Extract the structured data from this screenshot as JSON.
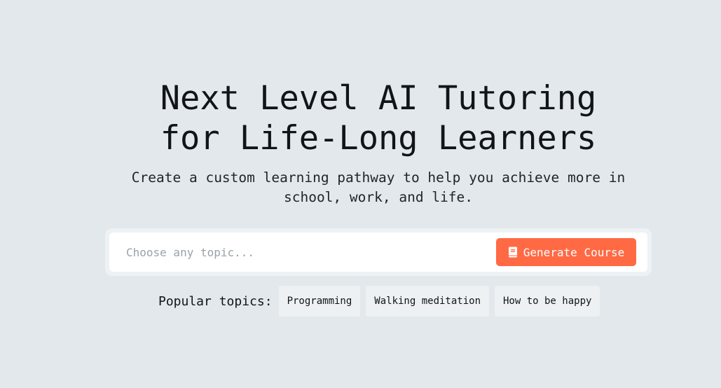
{
  "hero": {
    "title_line1": "Next Level AI Tutoring",
    "title_line2": "for Life-Long Learners",
    "subtitle_line1": "Create a custom learning pathway to help you achieve more in",
    "subtitle_line2": "school, work, and life."
  },
  "search": {
    "placeholder": "Choose any topic...",
    "value": "",
    "button_label": "Generate Course",
    "button_icon": "book-icon"
  },
  "popular": {
    "label": "Popular topics:",
    "topics": [
      "Programming",
      "Walking meditation",
      "How to be happy"
    ]
  },
  "colors": {
    "background": "#e2e8eb",
    "accent": "#ff6a45",
    "chip": "#edf1f3",
    "text": "#111418"
  }
}
